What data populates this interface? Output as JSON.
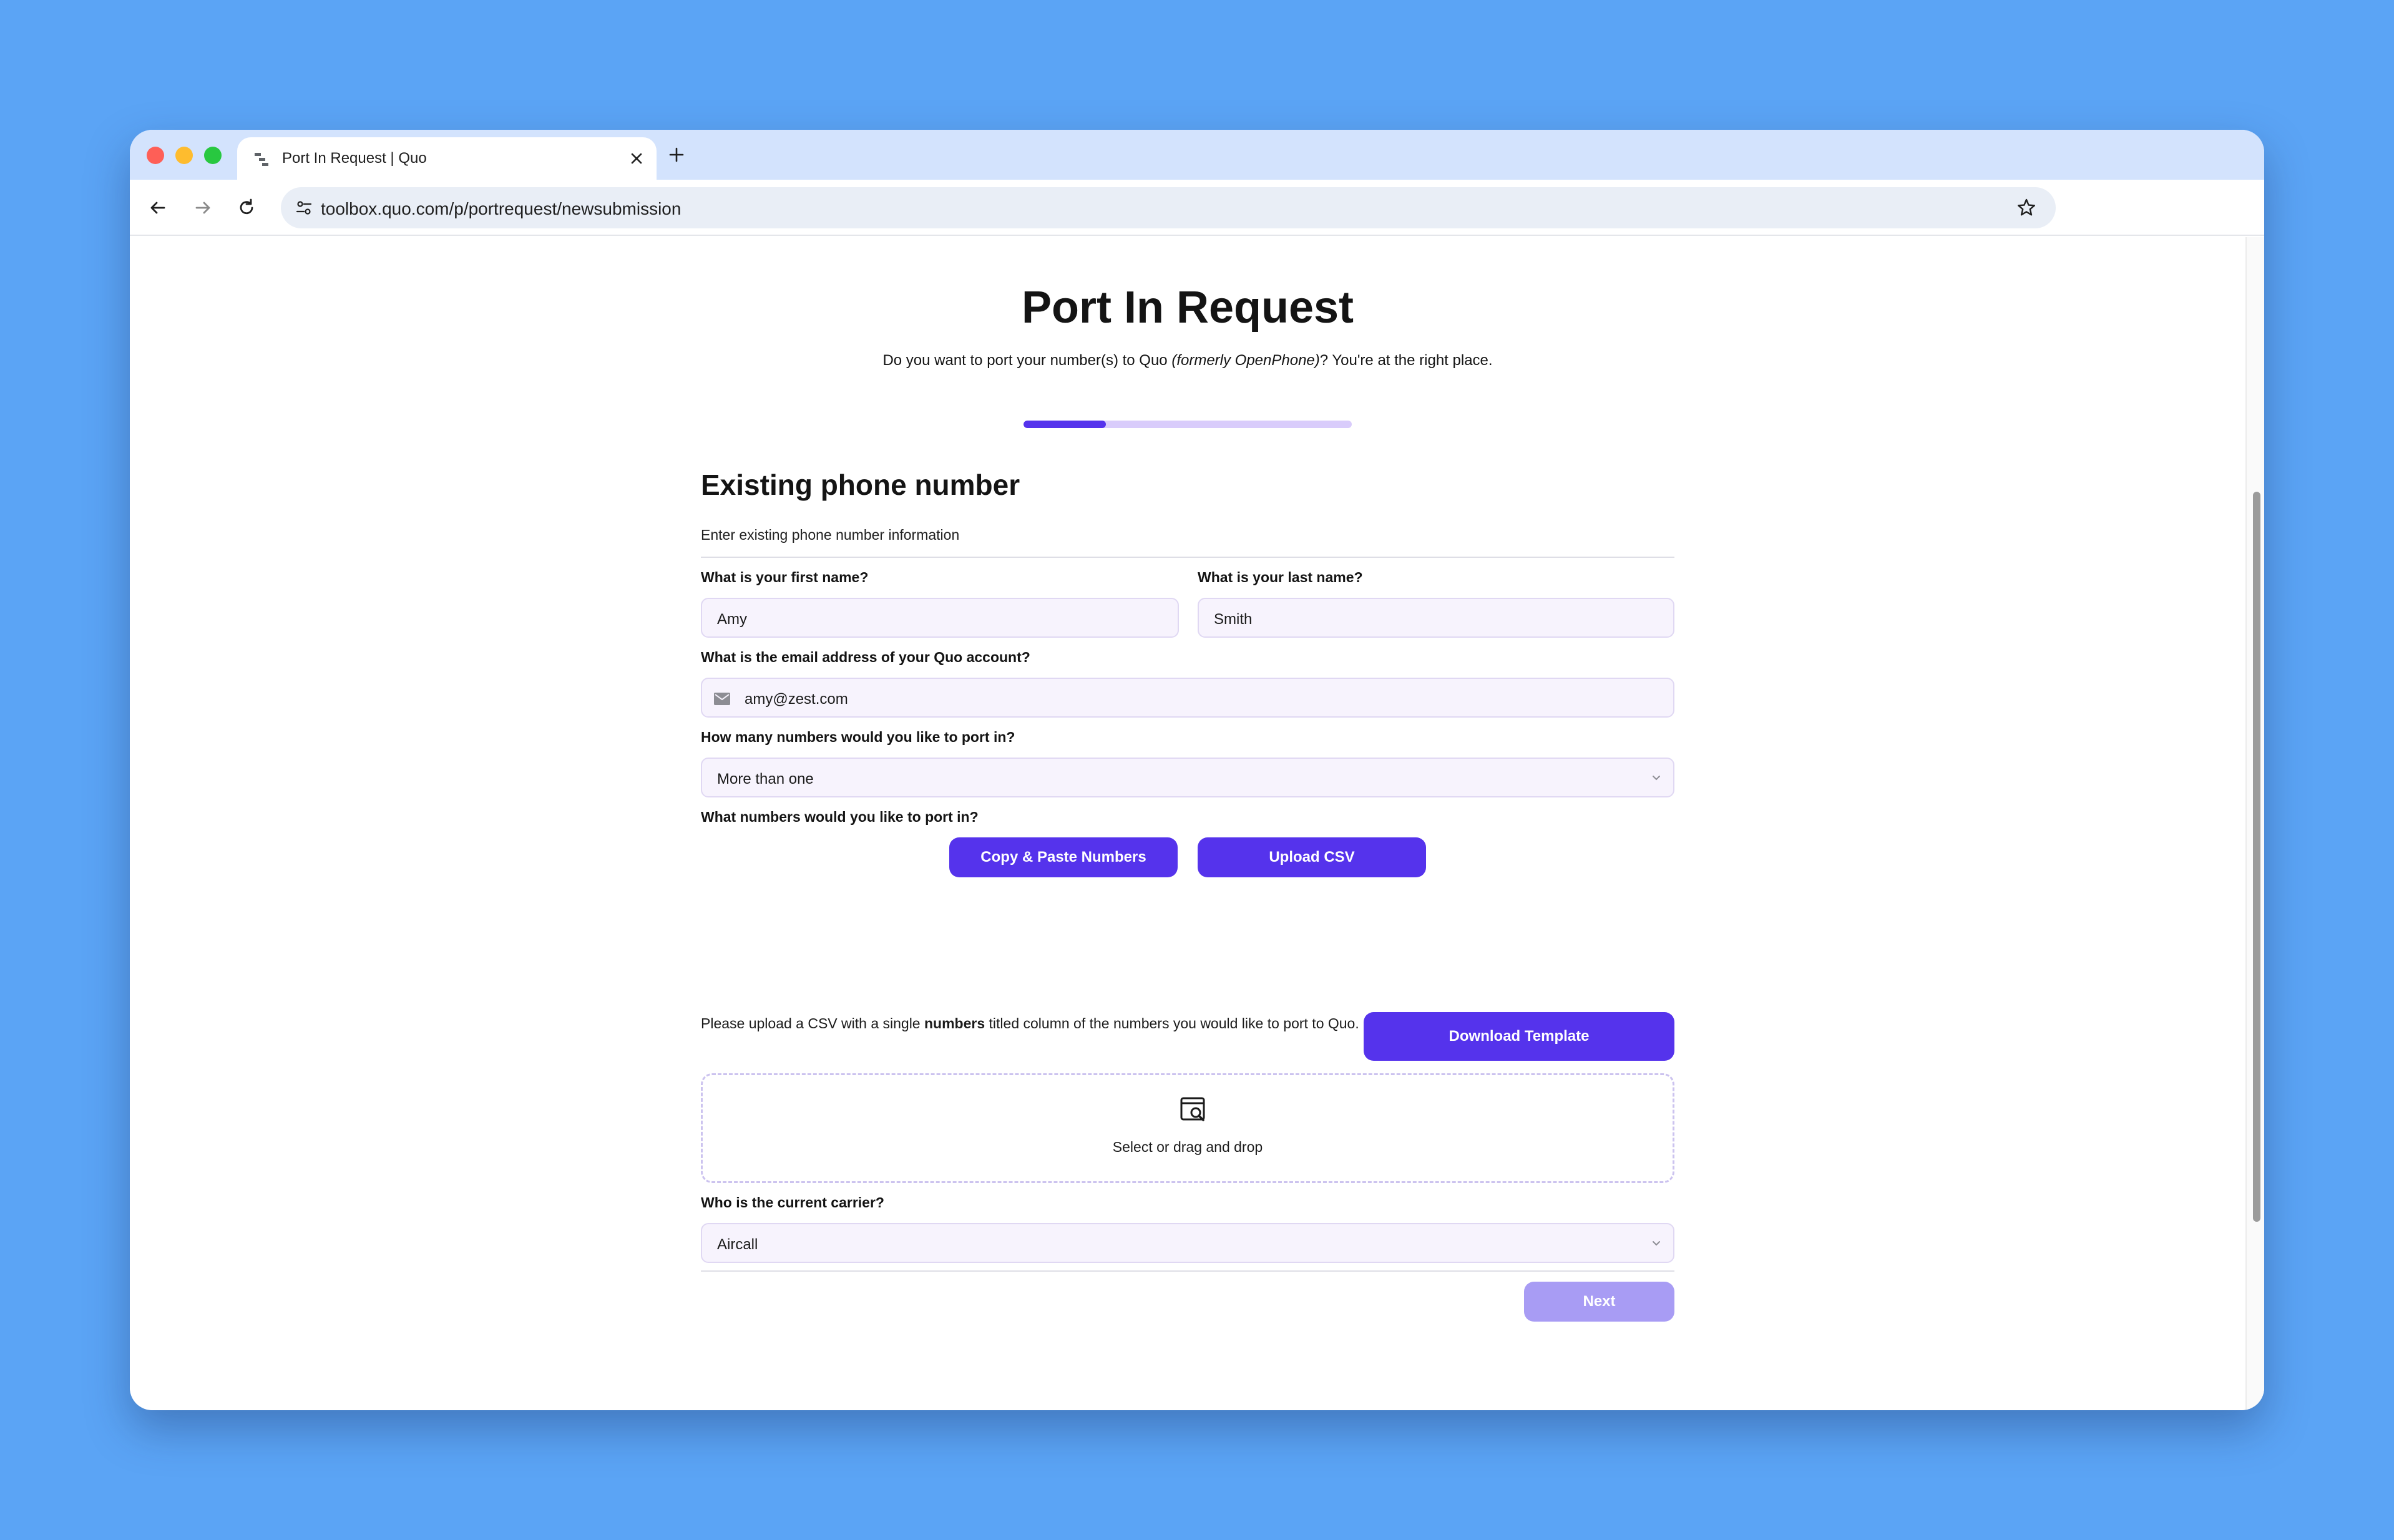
{
  "browser": {
    "tab_title": "Port In Request | Quo",
    "url": "toolbox.quo.com/p/portrequest/newsubmission"
  },
  "page": {
    "title": "Port In Request",
    "subtitle_before": "Do you want to port your number(s) to Quo ",
    "subtitle_italic": "(formerly OpenPhone)",
    "subtitle_after": "? You're at the right place.",
    "progress_fraction": 0.25
  },
  "section": {
    "title": "Existing phone number",
    "subtitle": "Enter existing phone number information"
  },
  "form": {
    "first_name_label": "What is your first name?",
    "first_name_value": "Amy",
    "last_name_label": "What is your last name?",
    "last_name_value": "Smith",
    "email_label": "What is the email address of your Quo account?",
    "email_value": "amy@zest.com",
    "count_label": "How many numbers would you like to port in?",
    "count_value": "More than one",
    "numbers_label": "What numbers would you like to port in?",
    "copy_paste_button": "Copy & Paste Numbers",
    "upload_csv_button": "Upload CSV",
    "csv_help_before": "Please upload a CSV with a single ",
    "csv_help_bold": "numbers",
    "csv_help_after": " titled column of the numbers you would like to port to Quo.",
    "download_template_button": "Download Template",
    "dropzone_text": "Select or drag and drop",
    "carrier_label": "Who is the current carrier?",
    "carrier_value": "Aircall",
    "next_button": "Next"
  },
  "colors": {
    "accent": "#5533ec",
    "accent_disabled": "#a89cf4",
    "field_bg": "#f7f3fd",
    "desktop_bg": "#5ba4f5"
  },
  "icons": [
    "close-icon",
    "plus-icon",
    "back-arrow-icon",
    "forward-arrow-icon",
    "reload-icon",
    "site-info-icon",
    "star-icon",
    "mail-icon",
    "chevron-down-icon",
    "file-search-icon"
  ]
}
